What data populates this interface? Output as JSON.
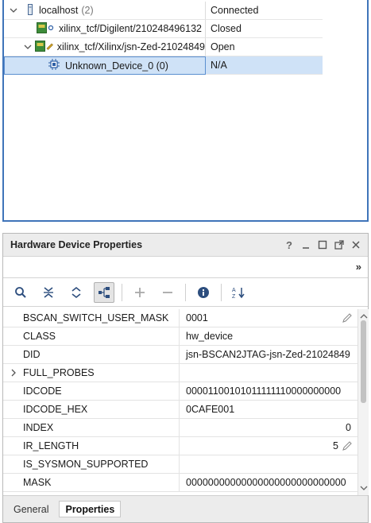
{
  "hardware_tree": {
    "rows": [
      {
        "name": "localhost",
        "count": "(2)",
        "status": "Connected",
        "icon": "server-icon",
        "expanded": true
      },
      {
        "name": "xilinx_tcf/Digilent/210248496132",
        "status": "Closed",
        "icon": "jtag-target-closed-icon"
      },
      {
        "name": "xilinx_tcf/Xilinx/jsn-Zed-21024849",
        "status": "Open",
        "icon": "jtag-target-open-icon",
        "expanded": true
      },
      {
        "name": "Unknown_Device_0 (0)",
        "status": "N/A",
        "icon": "chip-icon",
        "selected": true
      }
    ]
  },
  "properties": {
    "title": "Hardware Device Properties",
    "header_icons": [
      "help-icon",
      "minimize-icon",
      "maximize-icon",
      "float-icon",
      "close-icon"
    ],
    "more_chevrons": "»",
    "toolbar": [
      "search-icon",
      "collapse-all-icon",
      "expand-all-icon",
      "group-icon",
      "add-icon",
      "remove-icon",
      "info-icon",
      "sort-icon"
    ],
    "rows": [
      {
        "name": "BSCAN_SWITCH_USER_MASK",
        "value": "0001",
        "editable": true
      },
      {
        "name": "CLASS",
        "value": "hw_device"
      },
      {
        "name": "DID",
        "value": "jsn-BSCAN2JTAG-jsn-Zed-21024849"
      },
      {
        "name": "FULL_PROBES",
        "value": "",
        "expandable": true
      },
      {
        "name": "IDCODE",
        "value": "00001100101011111110000000000"
      },
      {
        "name": "IDCODE_HEX",
        "value": "0CAFE001"
      },
      {
        "name": "INDEX",
        "value": "0",
        "align": "right"
      },
      {
        "name": "IR_LENGTH",
        "value": "5",
        "align": "right",
        "editable": true
      },
      {
        "name": "IS_SYSMON_SUPPORTED",
        "value": ""
      },
      {
        "name": "MASK",
        "value": "00000000000000000000000000000"
      }
    ],
    "tabs": [
      {
        "label": "General",
        "active": false
      },
      {
        "label": "Properties",
        "active": true
      }
    ]
  },
  "colors": {
    "selection_bg": "#cfe2f7",
    "selection_border": "#5b8fd0",
    "panel_border": "#3f74b9",
    "icon_green": "#3d8c3a",
    "icon_blue": "#2d5fa6"
  }
}
